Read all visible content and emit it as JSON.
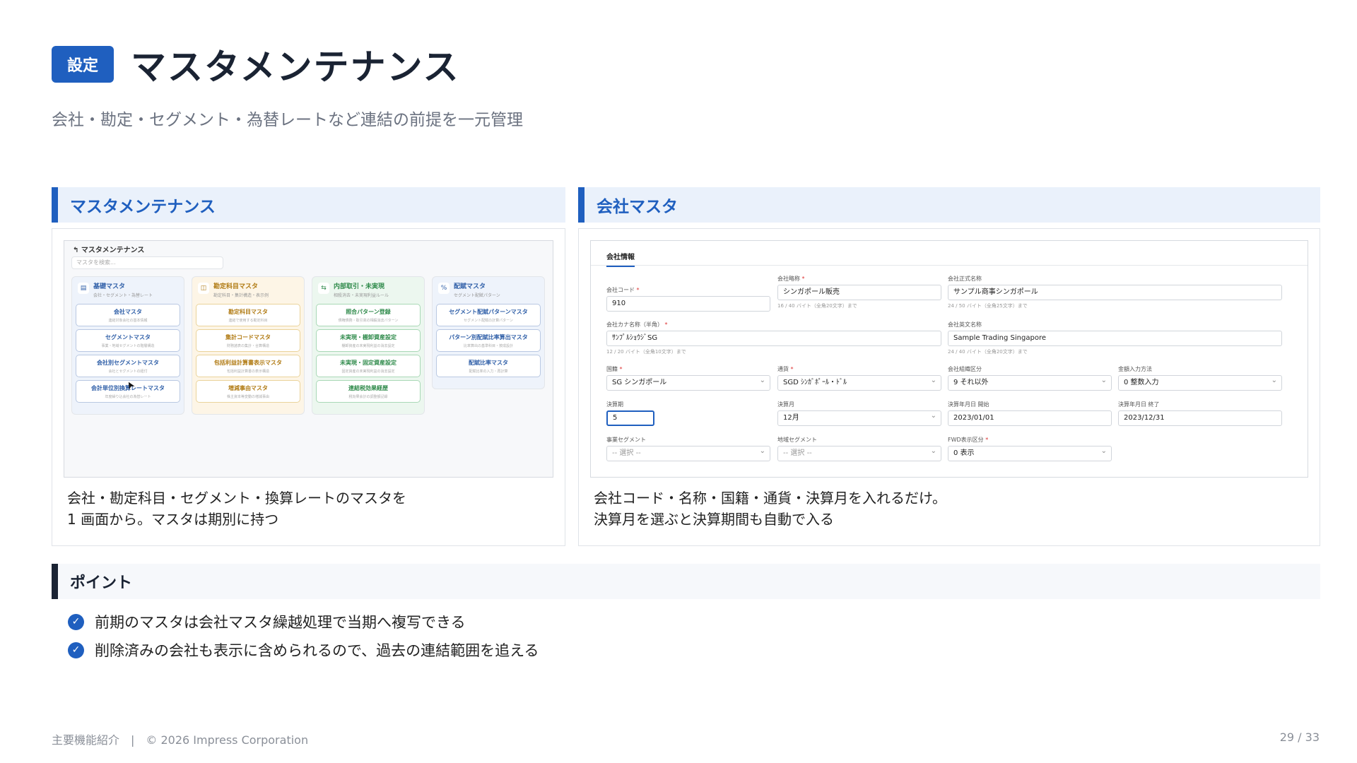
{
  "header": {
    "badge": "設定",
    "title": "マスタメンテナンス",
    "subtitle": "会社・勘定・セグメント・為替レートなど連結の前提を一元管理"
  },
  "left_panel": {
    "heading": "マスタメンテナンス",
    "caption_line1": "会社・勘定科目・セグメント・換算レートのマスタを",
    "caption_line2": "1 画面から。マスタは期別に持つ",
    "mock": {
      "title": "マスタメンテナンス",
      "search_placeholder": "マスタを検索...",
      "groups": [
        {
          "name": "基礎マスタ",
          "sub": "会社・セグメント・為替レート",
          "color": "#2f5fa8",
          "cards": [
            {
              "t": "会社マスタ",
              "s": "連結対象会社の基本情報"
            },
            {
              "t": "セグメントマスタ",
              "s": "事業・地域セグメントの階層構造"
            },
            {
              "t": "会社別セグメントマスタ",
              "s": "会社とセグメントの紐付"
            },
            {
              "t": "会計単位別換算レートマスタ",
              "s": "年度繰り込会社の為替レート"
            }
          ]
        },
        {
          "name": "勘定科目マスタ",
          "sub": "勘定科目・集計構造・表示例",
          "color": "#b07a12",
          "cards": [
            {
              "t": "勘定科目マスタ",
              "s": "連結で使用する勘定科目"
            },
            {
              "t": "集計コードマスタ",
              "s": "財務諸表の集計・合算構造"
            },
            {
              "t": "包括利益計算書表示マスタ",
              "s": "包括利益計算書の表示構造"
            },
            {
              "t": "増減事由マスタ",
              "s": "株主資本等変動の増減事由"
            }
          ]
        },
        {
          "name": "内部取引・未実現",
          "sub": "相殺消去・未実現利益ルール",
          "color": "#2e8a4a",
          "cards": [
            {
              "t": "照合パターン登録",
              "s": "債権債務・取引高の相殺消去パターン"
            },
            {
              "t": "未実現・棚卸資産設定",
              "s": "棚卸資産の未実現利益の消去設定"
            },
            {
              "t": "未実現・固定資産設定",
              "s": "固定資産の未実現利益の消去設定"
            },
            {
              "t": "連結税効果経歴",
              "s": "税効果会計の調整額記録"
            }
          ]
        },
        {
          "name": "配賦マスタ",
          "sub": "セグメント配賦パターン",
          "color": "#2f5fa8",
          "cards": [
            {
              "t": "セグメント配賦パターンマスタ",
              "s": "セグメント配賦の計算パターン"
            },
            {
              "t": "パターン別配賦比率算出マスタ",
              "s": "比率算出の基準科目・按成設計"
            },
            {
              "t": "配賦比率マスタ",
              "s": "配賦比率の入力・再計算"
            }
          ]
        }
      ]
    }
  },
  "right_panel": {
    "heading": "会社マスタ",
    "caption_line1": "会社コード・名称・国籍・通貨・決算月を入れるだけ。",
    "caption_line2": "決算月を選ぶと決算期間も自動で入る",
    "form": {
      "tab": "会社情報",
      "company_code_label": "会社コード",
      "company_code": "910",
      "short_name_label": "会社略称",
      "short_name": "シンガポール販売",
      "short_name_hint": "16 / 40 バイト（全角20文字）まで",
      "official_name_label": "会社正式名称",
      "official_name": "サンプル商事シンガポール",
      "official_name_hint": "24 / 50 バイト（全角25文字）まで",
      "kana_label": "会社カナ名称（半角）",
      "kana": "ｻﾝﾌﾟﾙｼｮｳｼﾞSG",
      "kana_hint": "12 / 20 バイト（全角10文字）まで",
      "english_label": "会社英文名称",
      "english": "Sample Trading Singapore",
      "english_hint": "24 / 40 バイト（全角20文字）まで",
      "country_label": "国籍",
      "country": "SG シンガポール",
      "currency_label": "通貨",
      "currency": "SGD ｼﾝｶﾞﾎﾟｰﾙ・ﾄﾞﾙ",
      "org_label": "会社組織区分",
      "org": "9 それ以外",
      "amount_label": "金額入力方法",
      "amount": "0 整数入力",
      "period_label": "決算期",
      "period": "5",
      "month_label": "決算月",
      "month": "12月",
      "start_label": "決算年月日 開始",
      "start": "2023/01/01",
      "end_label": "決算年月日 終了",
      "end": "2023/12/31",
      "biz_seg_label": "事業セグメント",
      "biz_seg": "-- 選択 --",
      "area_seg_label": "地域セグメント",
      "area_seg": "-- 選択 --",
      "fwd_label": "FWD表示区分",
      "fwd": "0 表示"
    }
  },
  "points": {
    "heading": "ポイント",
    "items": [
      "前期のマスタは会社マスタ繰越処理で当期へ複写できる",
      "削除済みの会社も表示に含められるので、過去の連結範囲を追える"
    ]
  },
  "footer": {
    "left": "主要機能紹介　|　© 2026 Impress Corporation",
    "page": "29 / 33"
  },
  "colors": {
    "accent": "#1f5fbf",
    "dark": "#1a2333"
  }
}
